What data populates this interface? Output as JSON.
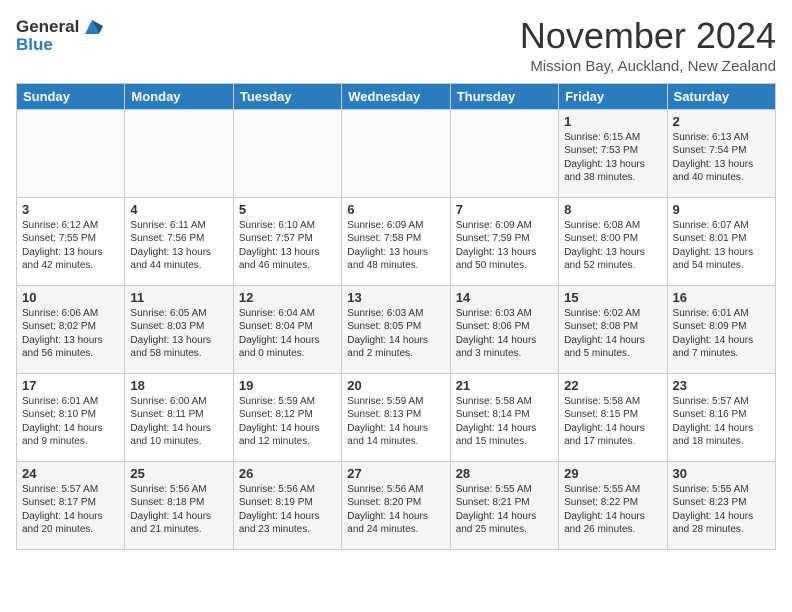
{
  "logo": {
    "general": "General",
    "blue": "Blue"
  },
  "header": {
    "title": "November 2024",
    "subtitle": "Mission Bay, Auckland, New Zealand"
  },
  "weekdays": [
    "Sunday",
    "Monday",
    "Tuesday",
    "Wednesday",
    "Thursday",
    "Friday",
    "Saturday"
  ],
  "weeks": [
    [
      {
        "day": "",
        "info": ""
      },
      {
        "day": "",
        "info": ""
      },
      {
        "day": "",
        "info": ""
      },
      {
        "day": "",
        "info": ""
      },
      {
        "day": "",
        "info": ""
      },
      {
        "day": "1",
        "info": "Sunrise: 6:15 AM\nSunset: 7:53 PM\nDaylight: 13 hours\nand 38 minutes."
      },
      {
        "day": "2",
        "info": "Sunrise: 6:13 AM\nSunset: 7:54 PM\nDaylight: 13 hours\nand 40 minutes."
      }
    ],
    [
      {
        "day": "3",
        "info": "Sunrise: 6:12 AM\nSunset: 7:55 PM\nDaylight: 13 hours\nand 42 minutes."
      },
      {
        "day": "4",
        "info": "Sunrise: 6:11 AM\nSunset: 7:56 PM\nDaylight: 13 hours\nand 44 minutes."
      },
      {
        "day": "5",
        "info": "Sunrise: 6:10 AM\nSunset: 7:57 PM\nDaylight: 13 hours\nand 46 minutes."
      },
      {
        "day": "6",
        "info": "Sunrise: 6:09 AM\nSunset: 7:58 PM\nDaylight: 13 hours\nand 48 minutes."
      },
      {
        "day": "7",
        "info": "Sunrise: 6:09 AM\nSunset: 7:59 PM\nDaylight: 13 hours\nand 50 minutes."
      },
      {
        "day": "8",
        "info": "Sunrise: 6:08 AM\nSunset: 8:00 PM\nDaylight: 13 hours\nand 52 minutes."
      },
      {
        "day": "9",
        "info": "Sunrise: 6:07 AM\nSunset: 8:01 PM\nDaylight: 13 hours\nand 54 minutes."
      }
    ],
    [
      {
        "day": "10",
        "info": "Sunrise: 6:06 AM\nSunset: 8:02 PM\nDaylight: 13 hours\nand 56 minutes."
      },
      {
        "day": "11",
        "info": "Sunrise: 6:05 AM\nSunset: 8:03 PM\nDaylight: 13 hours\nand 58 minutes."
      },
      {
        "day": "12",
        "info": "Sunrise: 6:04 AM\nSunset: 8:04 PM\nDaylight: 14 hours\nand 0 minutes."
      },
      {
        "day": "13",
        "info": "Sunrise: 6:03 AM\nSunset: 8:05 PM\nDaylight: 14 hours\nand 2 minutes."
      },
      {
        "day": "14",
        "info": "Sunrise: 6:03 AM\nSunset: 8:06 PM\nDaylight: 14 hours\nand 3 minutes."
      },
      {
        "day": "15",
        "info": "Sunrise: 6:02 AM\nSunset: 8:08 PM\nDaylight: 14 hours\nand 5 minutes."
      },
      {
        "day": "16",
        "info": "Sunrise: 6:01 AM\nSunset: 8:09 PM\nDaylight: 14 hours\nand 7 minutes."
      }
    ],
    [
      {
        "day": "17",
        "info": "Sunrise: 6:01 AM\nSunset: 8:10 PM\nDaylight: 14 hours\nand 9 minutes."
      },
      {
        "day": "18",
        "info": "Sunrise: 6:00 AM\nSunset: 8:11 PM\nDaylight: 14 hours\nand 10 minutes."
      },
      {
        "day": "19",
        "info": "Sunrise: 5:59 AM\nSunset: 8:12 PM\nDaylight: 14 hours\nand 12 minutes."
      },
      {
        "day": "20",
        "info": "Sunrise: 5:59 AM\nSunset: 8:13 PM\nDaylight: 14 hours\nand 14 minutes."
      },
      {
        "day": "21",
        "info": "Sunrise: 5:58 AM\nSunset: 8:14 PM\nDaylight: 14 hours\nand 15 minutes."
      },
      {
        "day": "22",
        "info": "Sunrise: 5:58 AM\nSunset: 8:15 PM\nDaylight: 14 hours\nand 17 minutes."
      },
      {
        "day": "23",
        "info": "Sunrise: 5:57 AM\nSunset: 8:16 PM\nDaylight: 14 hours\nand 18 minutes."
      }
    ],
    [
      {
        "day": "24",
        "info": "Sunrise: 5:57 AM\nSunset: 8:17 PM\nDaylight: 14 hours\nand 20 minutes."
      },
      {
        "day": "25",
        "info": "Sunrise: 5:56 AM\nSunset: 8:18 PM\nDaylight: 14 hours\nand 21 minutes."
      },
      {
        "day": "26",
        "info": "Sunrise: 5:56 AM\nSunset: 8:19 PM\nDaylight: 14 hours\nand 23 minutes."
      },
      {
        "day": "27",
        "info": "Sunrise: 5:56 AM\nSunset: 8:20 PM\nDaylight: 14 hours\nand 24 minutes."
      },
      {
        "day": "28",
        "info": "Sunrise: 5:55 AM\nSunset: 8:21 PM\nDaylight: 14 hours\nand 25 minutes."
      },
      {
        "day": "29",
        "info": "Sunrise: 5:55 AM\nSunset: 8:22 PM\nDaylight: 14 hours\nand 26 minutes."
      },
      {
        "day": "30",
        "info": "Sunrise: 5:55 AM\nSunset: 8:23 PM\nDaylight: 14 hours\nand 28 minutes."
      }
    ]
  ]
}
